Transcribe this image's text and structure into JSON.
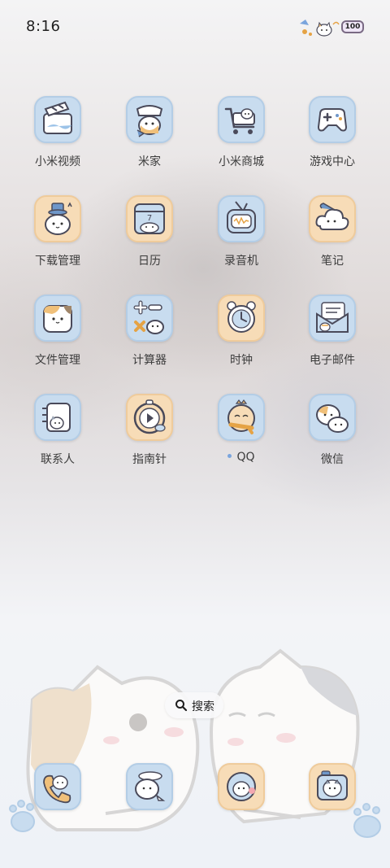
{
  "status_bar": {
    "time": "8:16",
    "battery": "100"
  },
  "apps": [
    {
      "label": "小米视频",
      "icon": "video-folder-icon"
    },
    {
      "label": "米家",
      "icon": "home-cat-icon"
    },
    {
      "label": "小米商城",
      "icon": "shopping-cart-icon"
    },
    {
      "label": "游戏中心",
      "icon": "gamepad-icon"
    },
    {
      "label": "下载管理",
      "icon": "hat-cat-icon"
    },
    {
      "label": "日历",
      "icon": "calendar-icon",
      "date": "7"
    },
    {
      "label": "录音机",
      "icon": "recorder-icon"
    },
    {
      "label": "笔记",
      "icon": "cloud-note-icon"
    },
    {
      "label": "文件管理",
      "icon": "folder-cat-icon"
    },
    {
      "label": "计算器",
      "icon": "calculator-icon"
    },
    {
      "label": "时钟",
      "icon": "alarm-clock-icon"
    },
    {
      "label": "电子邮件",
      "icon": "mail-icon"
    },
    {
      "label": "联系人",
      "icon": "contact-card-icon"
    },
    {
      "label": "指南针",
      "icon": "compass-icon"
    },
    {
      "label": "QQ",
      "icon": "qq-cat-icon"
    },
    {
      "label": "微信",
      "icon": "wechat-cats-icon"
    }
  ],
  "search": {
    "label": "搜索",
    "icon": "search-icon"
  },
  "dock": [
    {
      "icon": "phone-icon"
    },
    {
      "icon": "messages-icon"
    },
    {
      "icon": "browser-icon"
    },
    {
      "icon": "camera-icon"
    }
  ],
  "colors": {
    "icon_blue": "#c8dcef",
    "icon_peach": "#f7dcb7",
    "line": "#4a4a5a",
    "accent_blue": "#7aa5dd"
  }
}
